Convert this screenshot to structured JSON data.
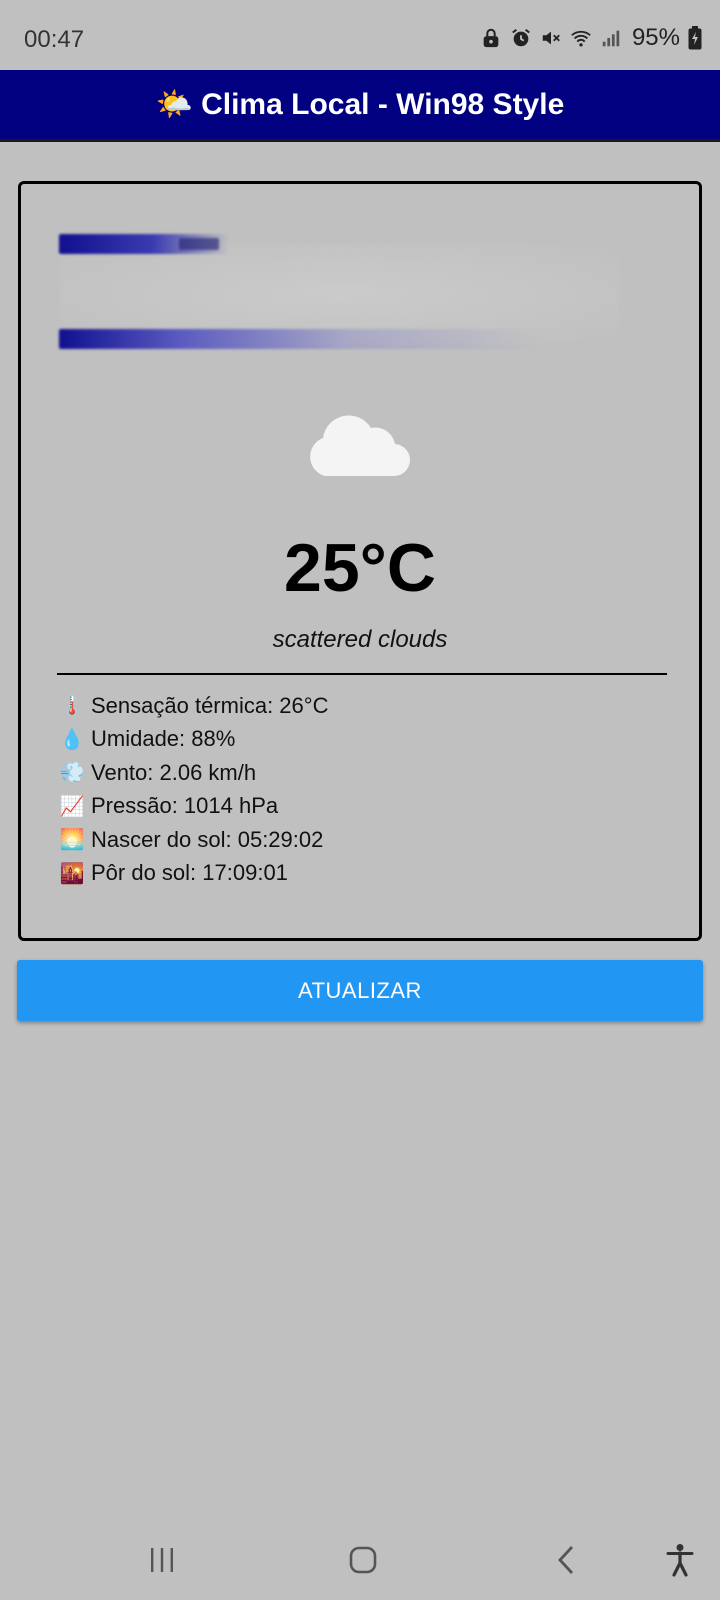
{
  "status_bar": {
    "time": "00:47",
    "battery": "95%",
    "icons": [
      "lock-icon",
      "alarm-icon",
      "mute-icon",
      "wifi-icon",
      "signal-icon",
      "battery-icon"
    ]
  },
  "header": {
    "icon": "🌤️",
    "title": "Clima Local - Win98 Style",
    "background": "#000080"
  },
  "weather": {
    "icon": "cloud-icon",
    "temperature": "25°C",
    "description": "scattered clouds",
    "details": [
      {
        "icon": "🌡️",
        "text": "Sensação térmica: 26°C"
      },
      {
        "icon": "💧",
        "text": "Umidade: 88%"
      },
      {
        "icon": "💨",
        "text": "Vento: 2.06 km/h"
      },
      {
        "icon": "📈",
        "text": "Pressão: 1014 hPa"
      },
      {
        "icon": "🌅",
        "text": "Nascer do sol: 05:29:02"
      },
      {
        "icon": "🌇",
        "text": "Pôr do sol: 17:09:01"
      }
    ]
  },
  "refresh_button": {
    "label": "ATUALIZAR",
    "color": "#2196f3"
  },
  "nav": {
    "recents": "recents-icon",
    "home": "home-icon",
    "back": "back-icon",
    "accessibility": "accessibility-icon"
  }
}
